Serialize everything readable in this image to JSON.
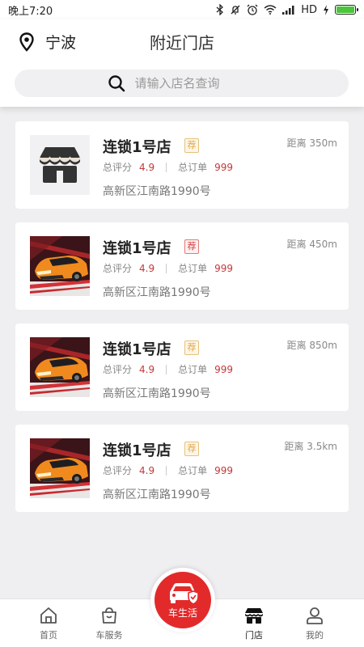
{
  "status_bar": {
    "time": "晚上7:20",
    "network": "HD"
  },
  "header": {
    "city": "宁波",
    "title": "附近门店",
    "search_placeholder": "请输入店名查询"
  },
  "stores": [
    {
      "name": "连锁1号店",
      "badge": "荐",
      "badge_style": "gold",
      "distance": "距离 350m",
      "rating_label": "总评分",
      "rating": "4.9",
      "orders_label": "总订单",
      "orders": "999",
      "address": "高新区江南路1990号",
      "image": "store-icon"
    },
    {
      "name": "连锁1号店",
      "badge": "荐",
      "badge_style": "red",
      "distance": "距离 450m",
      "rating_label": "总评分",
      "rating": "4.9",
      "orders_label": "总订单",
      "orders": "999",
      "address": "高新区江南路1990号",
      "image": "car-photo"
    },
    {
      "name": "连锁1号店",
      "badge": "荐",
      "badge_style": "gold",
      "distance": "距离 850m",
      "rating_label": "总评分",
      "rating": "4.9",
      "orders_label": "总订单",
      "orders": "999",
      "address": "高新区江南路1990号",
      "image": "car-photo"
    },
    {
      "name": "连锁1号店",
      "badge": "荐",
      "badge_style": "gold",
      "distance": "距离 3.5km",
      "rating_label": "总评分",
      "rating": "4.9",
      "orders_label": "总订单",
      "orders": "999",
      "address": "高新区江南路1990号",
      "image": "car-photo"
    }
  ],
  "bottom_nav": {
    "home": "首页",
    "car_service": "车服务",
    "car_life": "车生活",
    "stores": "门店",
    "mine": "我的"
  },
  "colors": {
    "accent": "#e32a2b",
    "value": "#c3383a",
    "badge_gold": "#e0a64a"
  }
}
